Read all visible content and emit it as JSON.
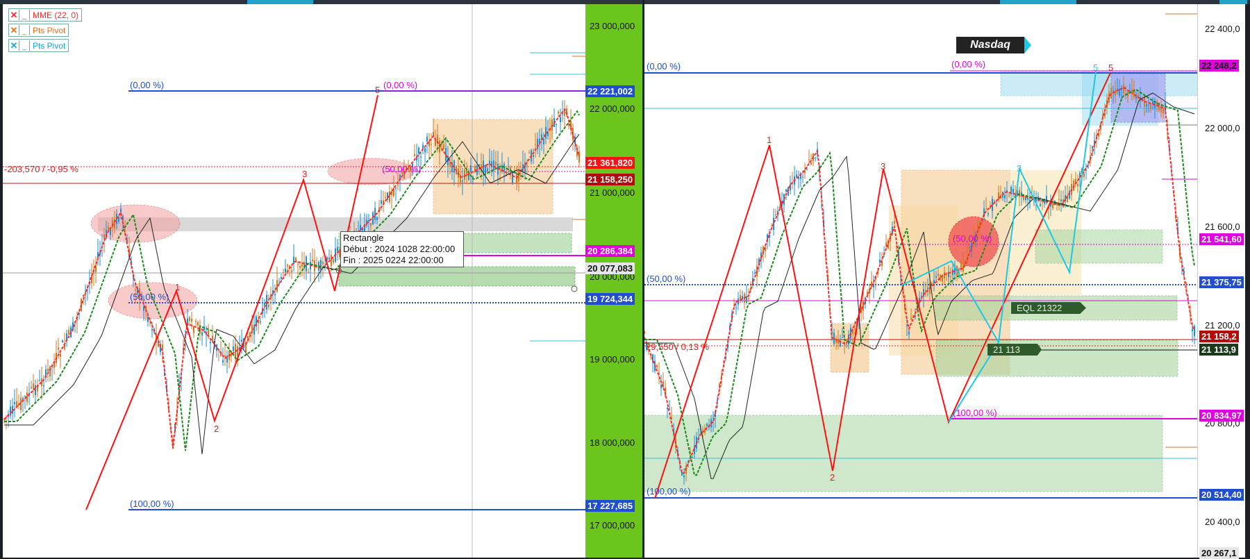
{
  "top_strip": {
    "tabs": [
      "",
      "",
      ""
    ]
  },
  "left_chart": {
    "legend": [
      {
        "state": "✕",
        "state_color": "#ff2a2a",
        "label": "MME (22, 0)",
        "label_color": "#ff2a2a"
      },
      {
        "state": "✕",
        "state_color": "#e07020",
        "label": "Pts Pivot",
        "label_color": "#e07020"
      },
      {
        "state": "✕",
        "state_color": "#19a3d8",
        "label": "Pts Pivot",
        "label_color": "#19a3d8"
      }
    ],
    "axis_ticks": [
      "23 000,000",
      "22 000,000",
      "21 000,000",
      "20 000,000",
      "19 000,000",
      "18 000,000",
      "17 000,000"
    ],
    "price_tags": [
      {
        "text": "22 221,002",
        "bg": "#1f4fd0",
        "fg": "#ffffff"
      },
      {
        "text": "21 361,820",
        "bg": "#ff1010",
        "fg": "#ffffff"
      },
      {
        "text": "21 158,250",
        "bg": "#b40a0a",
        "fg": "#ffffff"
      },
      {
        "text": "20 286,384",
        "bg": "#e000e0",
        "fg": "#ffffff"
      },
      {
        "text": "20 077,083",
        "bg": "#e6e6e6",
        "fg": "#111111"
      },
      {
        "text": "19 724,344",
        "bg": "#1f4fd0",
        "fg": "#ffffff"
      },
      {
        "text": "17 227,685",
        "bg": "#1f4fd0",
        "fg": "#ffffff"
      }
    ],
    "fib_labels": {
      "top_blue": "(0,00 %)",
      "top_magenta": "(0,00 %)",
      "mid_blue": "(50,00 %)",
      "mid_magenta": "(50,00 %)",
      "bottom_blue": "(100,00 %)"
    },
    "change_label": "-203,570 / -0,95 %",
    "wave_labels": [
      "1",
      "2",
      "3",
      "5"
    ],
    "tooltip": {
      "title": "Rectangle",
      "start": "Début : 2024 1028 22:00:00",
      "end": "Fin : 2025 0224 22:00:00"
    }
  },
  "right_chart": {
    "title_badge": "Nasdaq",
    "axis_ticks": [
      "22 400,0",
      "22 000,0",
      "21 600,0",
      "21 200,0",
      "20 800,0",
      "20 400,0"
    ],
    "price_tags": [
      {
        "text": "22 248,2",
        "bg": "#e000e0",
        "fg": "#111111"
      },
      {
        "text": "21 541,60",
        "bg": "#e000e0",
        "fg": "#ffffff"
      },
      {
        "text": "21 375,75",
        "bg": "#1f4fd0",
        "fg": "#ffffff"
      },
      {
        "text": "21 158,2",
        "bg": "#b40a0a",
        "fg": "#ffffff"
      },
      {
        "text": "21 113,9",
        "bg": "#1b3a1b",
        "fg": "#ffffff"
      },
      {
        "text": "20 834,97",
        "bg": "#e000e0",
        "fg": "#ffffff"
      },
      {
        "text": "20 514,40",
        "bg": "#1f4fd0",
        "fg": "#ffffff"
      },
      {
        "text": "20 267,1",
        "bg": "#e6e6e6",
        "fg": "#111111"
      }
    ],
    "fib_labels": {
      "top_blue": "(0,00 %)",
      "top_magenta": "(0,00 %)",
      "mid_blue": "(50,00 %)",
      "mid_magenta": "(50,00 %)",
      "bottom_magenta": "(100,00 %)",
      "bottom_blue": "(100,00 %)"
    },
    "change_label": "29,550 / 0,13 %",
    "wave_labels": [
      "1",
      "2",
      "3",
      "5"
    ],
    "cyan_wave_labels": [
      "3",
      "5"
    ],
    "eql_label": "EQL  21322",
    "level_label": "21 113"
  }
}
